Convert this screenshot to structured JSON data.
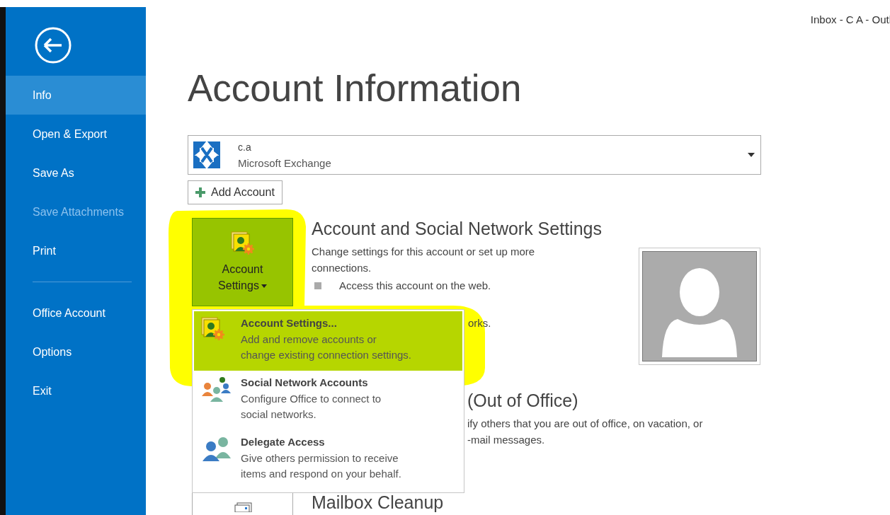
{
  "window": {
    "title": "Inbox - C A - Outl"
  },
  "sidebar": {
    "items": [
      {
        "label": "Info",
        "selected": true,
        "disabled": false
      },
      {
        "label": "Open & Export",
        "selected": false,
        "disabled": false
      },
      {
        "label": "Save As",
        "selected": false,
        "disabled": false
      },
      {
        "label": "Save Attachments",
        "selected": false,
        "disabled": true
      },
      {
        "label": "Print",
        "selected": false,
        "disabled": false
      }
    ],
    "lower_items": [
      {
        "label": "Office Account",
        "selected": false,
        "disabled": false
      },
      {
        "label": "Options",
        "selected": false,
        "disabled": false
      },
      {
        "label": "Exit",
        "selected": false,
        "disabled": false
      }
    ]
  },
  "title": "Account Information",
  "account": {
    "name": "c.a",
    "type": "Microsoft Exchange"
  },
  "add_account_button": "Add Account",
  "settings_section": {
    "button": "Account Settings",
    "heading": "Account and Social Network Settings",
    "description_lines": [
      "Change settings for this account or set up more",
      "connections."
    ],
    "bullets": [
      "Access this account on the web."
    ],
    "covered_line": "orks."
  },
  "covered_section": {
    "heading": "(Out of Office)",
    "description_lines": [
      "ify others that you are out of office, on vacation, or",
      "-mail messages."
    ]
  },
  "cleanup_section": {
    "heading": "Mailbox Cleanup"
  },
  "menu": {
    "items": [
      {
        "kind": "settings",
        "title": "Account Settings...",
        "description_lines": [
          "Add and remove accounts or",
          "change existing connection settings."
        ],
        "selected": true
      },
      {
        "kind": "social",
        "title": "Social Network Accounts",
        "description_lines": [
          "Configure Office to connect to",
          "social networks."
        ],
        "selected": false
      },
      {
        "kind": "delegate",
        "title": "Delegate Access",
        "description_lines": [
          "Give others permission to receive",
          "items and respond on your behalf."
        ],
        "selected": false
      }
    ]
  }
}
